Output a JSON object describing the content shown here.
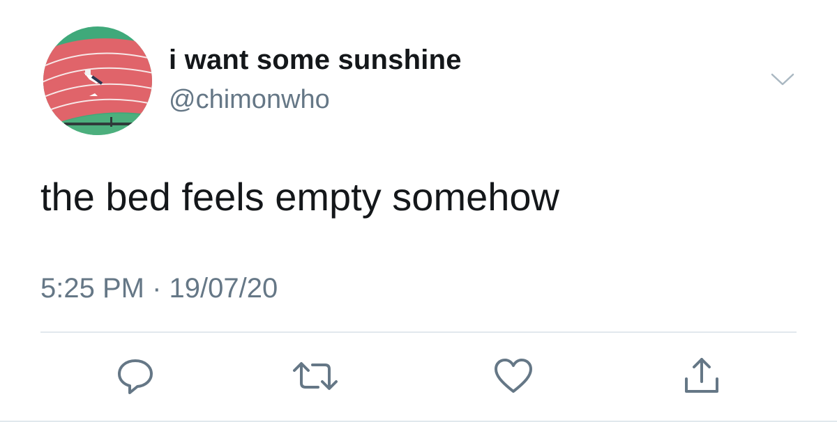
{
  "user": {
    "display_name": "i want some sunshine",
    "handle": "@chimonwho"
  },
  "tweet": {
    "text": "the bed feels empty somehow",
    "time": "5:25 PM",
    "separator": "·",
    "date": "19/07/20"
  },
  "icons": {
    "more": "chevron-down-icon",
    "reply": "reply-icon",
    "retweet": "retweet-icon",
    "like": "heart-icon",
    "share": "share-icon"
  },
  "colors": {
    "text": "#14171a",
    "secondary": "#657786",
    "icon": "#657786",
    "divider": "#e1e8ed"
  }
}
